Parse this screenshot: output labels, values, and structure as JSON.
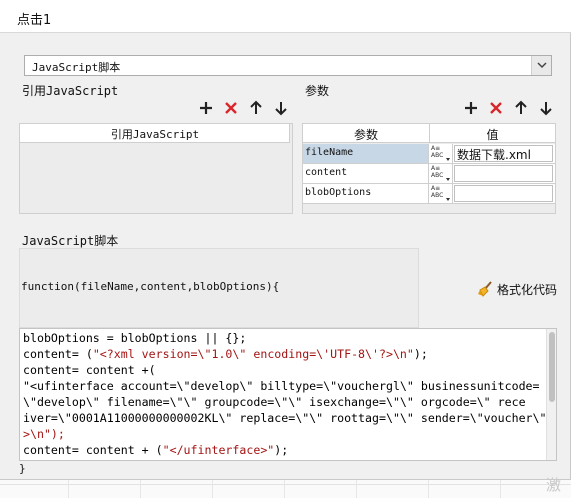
{
  "window": {
    "title": "点击1"
  },
  "action_type": {
    "selected": "JavaScript脚本"
  },
  "ref_js": {
    "section_label": "引用JavaScript",
    "column_header": "引用JavaScript"
  },
  "params": {
    "section_label": "参数",
    "headers": {
      "name": "参数",
      "value": "值"
    },
    "type_glyph": "A≡\nABC",
    "rows": [
      {
        "name": "fileName",
        "value": "数据下载.xml"
      },
      {
        "name": "content",
        "value": ""
      },
      {
        "name": "blobOptions",
        "value": ""
      }
    ]
  },
  "script": {
    "section_label": "JavaScript脚本",
    "function_signature": "function(fileName,content,blobOptions){",
    "format_label": "格式化代码",
    "closing_brace": "}"
  },
  "code": {
    "line1": "blobOptions = blobOptions || {};",
    "line2a": "content= (",
    "line2b": "\"<?xml version=\\\"1.0\\\" encoding=\\'UTF-8\\'?>\\n\"",
    "line2c": ");",
    "line3a": "content= content +(",
    "line4": "\"<ufinterface account=\\\"develop\\\" billtype=\\\"vouchergl\\\" businessunitcode=",
    "line5": "\\\"develop\\\" filename=\\\"\\\" groupcode=\\\"\\\" isexchange=\\\"\\\" orgcode=\\\" rece",
    "line6": "iver=\\\"0001A11000000000002KL\\\" replace=\\\"\\\" roottag=\\\"\\\" sender=\\\"voucher\\\"",
    "line7": ">\\n\");",
    "line8a": "content= content + (",
    "line8b": "\"</ufinterface>\"",
    "line8c": ");"
  },
  "watermark": "激活"
}
